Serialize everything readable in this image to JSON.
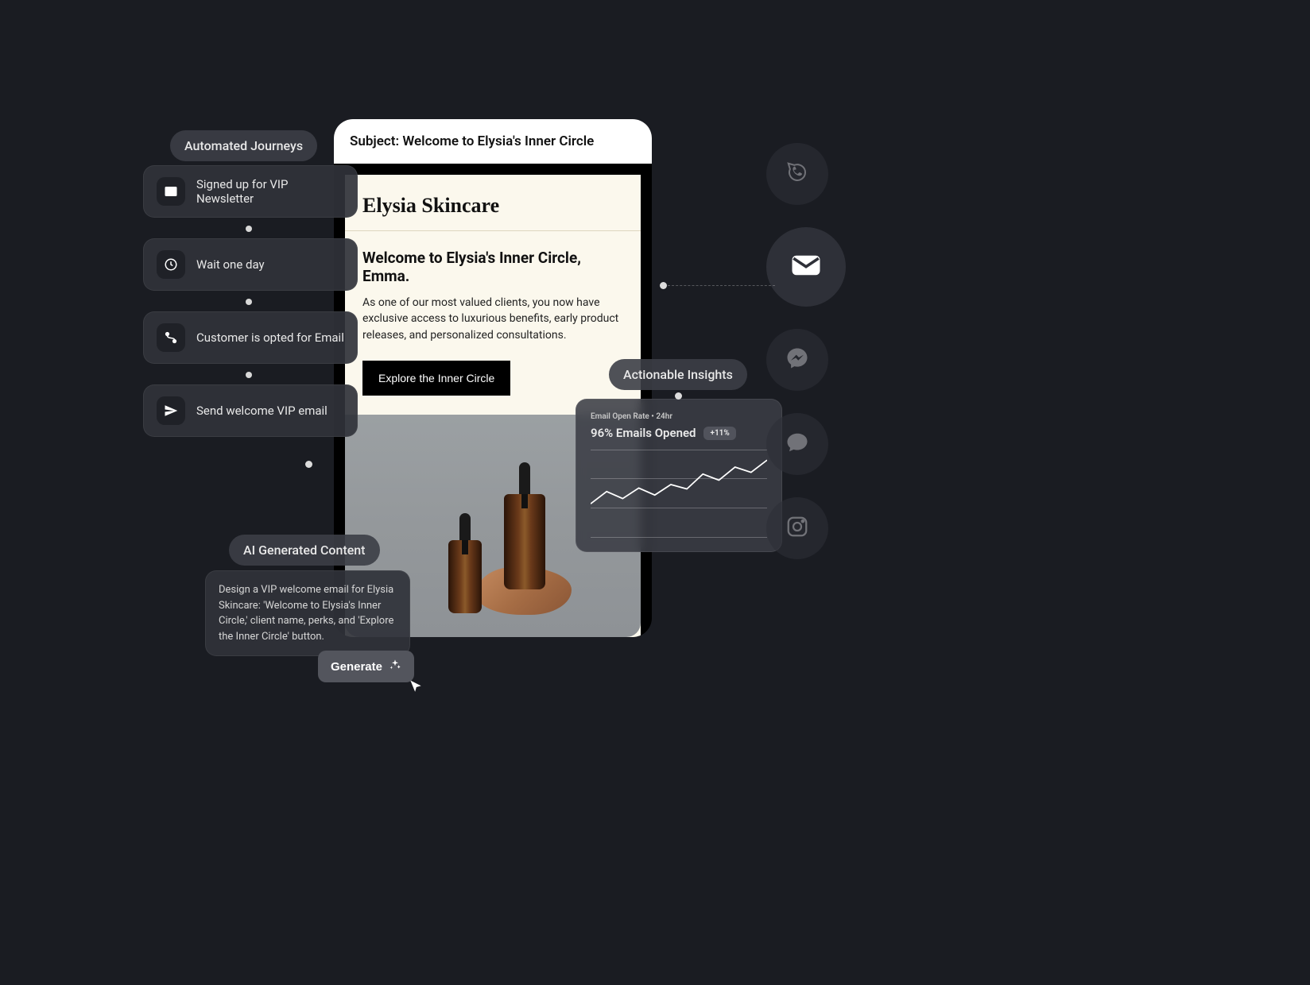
{
  "labels": {
    "automated_journeys": "Automated Journeys",
    "ai_generated_content": "AI Generated Content",
    "actionable_insights": "Actionable Insights"
  },
  "journeys": {
    "step1": "Signed up for VIP Newsletter",
    "step2": "Wait one day",
    "step3": "Customer is opted for Email",
    "step4": "Send welcome VIP email"
  },
  "email": {
    "subject": "Subject: Welcome to Elysia's Inner Circle",
    "brand": "Elysia Skincare",
    "heading": "Welcome to Elysia's Inner Circle, Emma.",
    "paragraph": "As one of our most valued clients, you now have exclusive access to luxurious benefits, early product releases, and personalized consultations.",
    "cta": "Explore the Inner Circle"
  },
  "ai": {
    "prompt": "Design a VIP welcome email for Elysia Skincare: 'Welcome to Elysia's Inner Circle,' client name, perks, and 'Explore the Inner Circle' button.",
    "generate": "Generate"
  },
  "insights": {
    "meta": "Email Open Rate • 24hr",
    "headline": "96% Emails Opened",
    "delta": "+11%"
  },
  "channels": {
    "whatsapp": "whatsapp",
    "email": "email",
    "messenger": "messenger",
    "chat": "chat",
    "instagram": "instagram"
  },
  "chart_data": {
    "type": "line",
    "title": "Email Open Rate • 24hr",
    "xlabel": "",
    "ylabel": "",
    "ylim": [
      0,
      100
    ],
    "x": [
      0,
      1,
      2,
      3,
      4,
      5,
      6,
      7,
      8,
      9,
      10,
      11
    ],
    "values": [
      38,
      52,
      44,
      56,
      48,
      60,
      55,
      72,
      65,
      80,
      74,
      88
    ]
  }
}
